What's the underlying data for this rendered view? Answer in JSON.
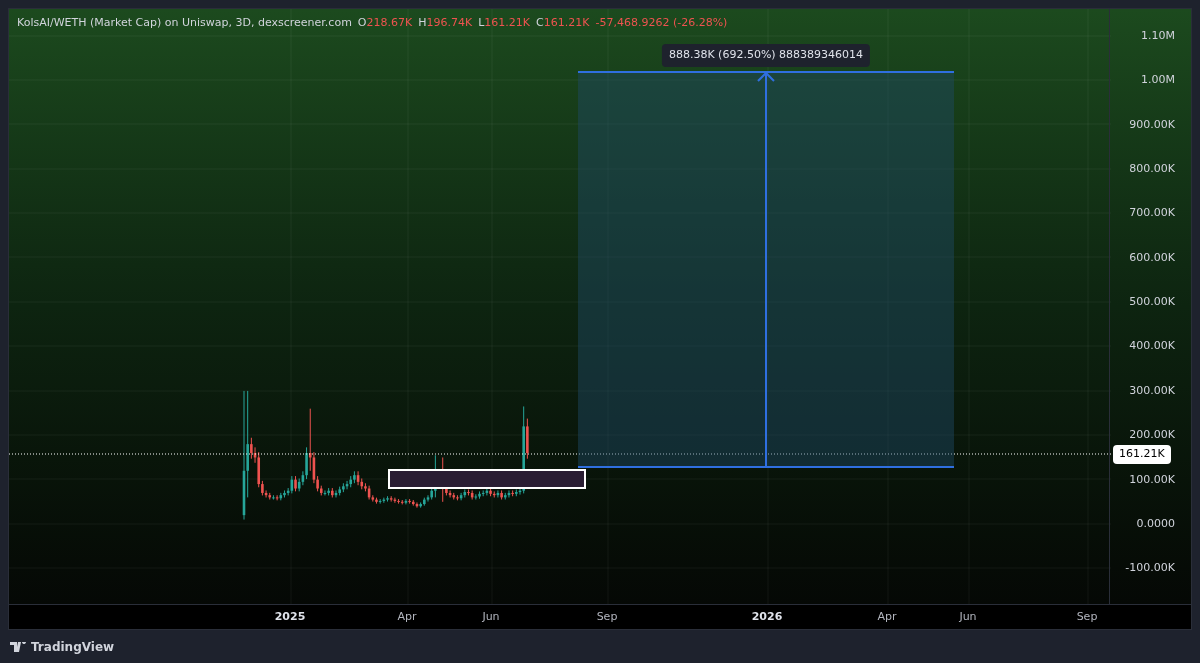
{
  "legend": {
    "symbol": "KolsAI/WETH (Market Cap) on Uniswap, 3D, dexscreener.com",
    "values": [
      {
        "label": "O",
        "value": "218.67K"
      },
      {
        "label": "H",
        "value": "196.74K"
      },
      {
        "label": "L",
        "value": "161.21K"
      },
      {
        "label": "C",
        "value": "161.21K"
      }
    ],
    "change": "-57,468.9262 (-26.28%)"
  },
  "measure_label": "888.38K (692.50%) 888389346014",
  "price_axis": {
    "ticks": [
      "1.10M",
      "1.00M",
      "900.00K",
      "800.00K",
      "700.00K",
      "600.00K",
      "500.00K",
      "400.00K",
      "300.00K",
      "200.00K",
      "100.00K",
      "0.0000",
      "-100.00K"
    ],
    "current_price": "161.21K"
  },
  "time_axis": {
    "ticks": [
      {
        "label": "2025",
        "emphasized": true
      },
      {
        "label": "Apr",
        "emphasized": false
      },
      {
        "label": "Jun",
        "emphasized": false
      },
      {
        "label": "Sep",
        "emphasized": false
      },
      {
        "label": "2026",
        "emphasized": true
      },
      {
        "label": "Apr",
        "emphasized": false
      },
      {
        "label": "Jun",
        "emphasized": false
      },
      {
        "label": "Sep",
        "emphasized": false
      }
    ]
  },
  "brand": "TradingView"
}
